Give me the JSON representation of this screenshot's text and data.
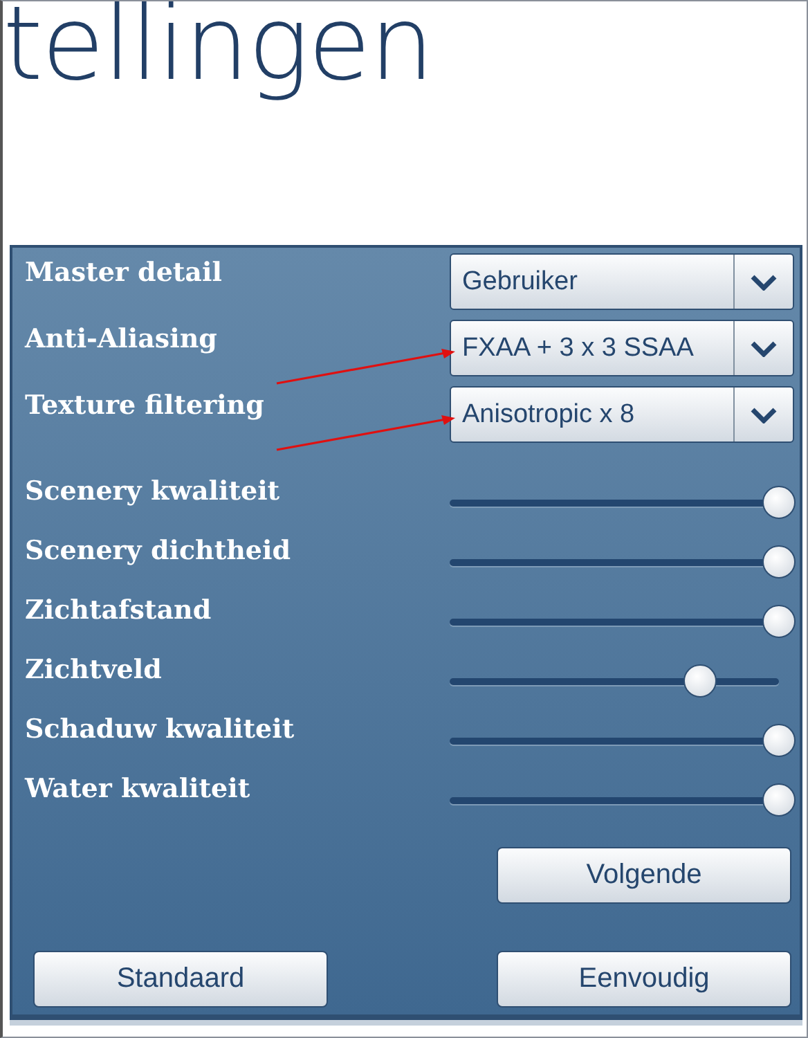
{
  "heading": "tellingen",
  "dropdowns": [
    {
      "label": "Master detail",
      "value": "Gebruiker",
      "marked": false
    },
    {
      "label": "Anti-Aliasing",
      "value": "FXAA + 3 x 3 SSAA",
      "marked": true
    },
    {
      "label": "Texture filtering",
      "value": "Anisotropic x 8",
      "marked": true
    }
  ],
  "sliders": [
    {
      "label": "Scenery kwaliteit",
      "level": 1
    },
    {
      "label": "Scenery dichtheid",
      "level": 1
    },
    {
      "label": "Zichtafstand",
      "level": 1
    },
    {
      "label": "Zichtveld",
      "level": 0.76
    },
    {
      "label": "Schaduw kwaliteit",
      "level": 1
    },
    {
      "label": "Water kwaliteit",
      "level": 1
    }
  ],
  "next_button": "Volgende",
  "buttons": [
    "Standaard",
    "Eenvoudig"
  ]
}
